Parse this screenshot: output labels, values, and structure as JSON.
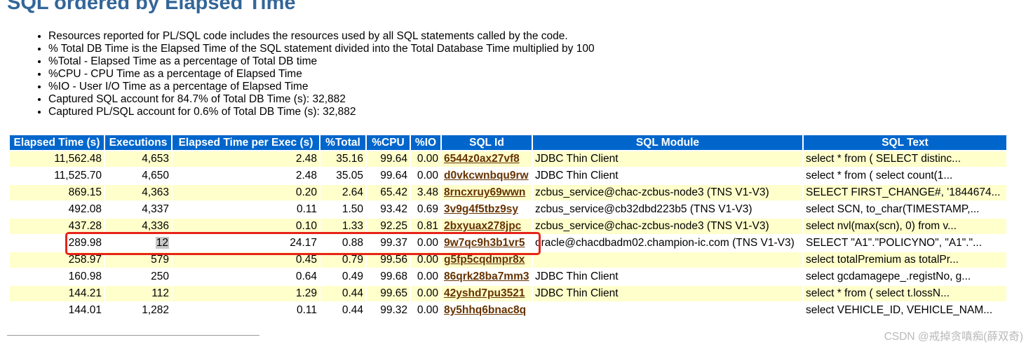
{
  "report": {
    "title": "SQL ordered by Elapsed Time",
    "notes": [
      "Resources reported for PL/SQL code includes the resources used by all SQL statements called by the code.",
      "% Total DB Time is the Elapsed Time of the SQL statement divided into the Total Database Time multiplied by 100",
      "%Total - Elapsed Time as a percentage of Total DB time",
      "%CPU - CPU Time as a percentage of Elapsed Time",
      "%IO - User I/O Time as a percentage of Elapsed Time",
      "Captured SQL account for 84.7% of Total DB Time (s): 32,882",
      "Captured PL/SQL account for 0.6% of Total DB Time (s): 32,882"
    ]
  },
  "table": {
    "columns": [
      "Elapsed Time (s)",
      "Executions",
      "Elapsed Time per Exec (s)",
      "%Total",
      "%CPU",
      "%IO",
      "SQL Id",
      "SQL Module",
      "SQL Text"
    ],
    "rows": [
      {
        "elapsed": "11,562.48",
        "executions": "4,653",
        "per_exec": "2.48",
        "total": "35.16",
        "cpu": "99.64",
        "io": "0.00",
        "sql_id": "6544z0ax27vf8",
        "module": "JDBC Thin Client",
        "text": "select * from ( SELECT distinc..."
      },
      {
        "elapsed": "11,525.70",
        "executions": "4,650",
        "per_exec": "2.48",
        "total": "35.05",
        "cpu": "99.64",
        "io": "0.00",
        "sql_id": "d0vkcwnbqu9rw",
        "module": "JDBC Thin Client",
        "text": "select * from ( select count(1..."
      },
      {
        "elapsed": "869.15",
        "executions": "4,363",
        "per_exec": "0.20",
        "total": "2.64",
        "cpu": "65.42",
        "io": "3.48",
        "sql_id": "8rncxruy69wwn",
        "module": "zcbus_service@chac-zcbus-node3 (TNS V1-V3)",
        "text": "SELECT FIRST_CHANGE#, '1844674..."
      },
      {
        "elapsed": "492.08",
        "executions": "4,337",
        "per_exec": "0.11",
        "total": "1.50",
        "cpu": "93.42",
        "io": "0.69",
        "sql_id": "3v9g4f5tbz9sy",
        "module": "zcbus_service@cb32dbd223b5 (TNS V1-V3)",
        "text": "select SCN, to_char(TIMESTAMP,..."
      },
      {
        "elapsed": "437.28",
        "executions": "4,336",
        "per_exec": "0.10",
        "total": "1.33",
        "cpu": "92.25",
        "io": "0.81",
        "sql_id": "2bxyuax278jpc",
        "module": "zcbus_service@chac-zcbus-node3 (TNS V1-V3)",
        "text": "select nvl(max(scn), 0) from v..."
      },
      {
        "elapsed": "289.98",
        "executions": "12",
        "per_exec": "24.17",
        "total": "0.88",
        "cpu": "99.37",
        "io": "0.00",
        "sql_id": "9w7qc9h3b1vr5",
        "module": "oracle@chacdbadm02.champion-ic.com (TNS V1-V3)",
        "text": "SELECT \"A1\".\"POLICYNO\", \"A1\".\"..."
      },
      {
        "elapsed": "258.97",
        "executions": "579",
        "per_exec": "0.45",
        "total": "0.79",
        "cpu": "99.56",
        "io": "0.00",
        "sql_id": "g5fp5cqdmpr8x",
        "module": "",
        "text": "select totalPremium as totalPr..."
      },
      {
        "elapsed": "160.98",
        "executions": "250",
        "per_exec": "0.64",
        "total": "0.49",
        "cpu": "99.68",
        "io": "0.00",
        "sql_id": "86qrk28ba7mm3",
        "module": "JDBC Thin Client",
        "text": "select gcdamagepe_.registNo, g..."
      },
      {
        "elapsed": "144.21",
        "executions": "112",
        "per_exec": "1.29",
        "total": "0.44",
        "cpu": "99.65",
        "io": "0.00",
        "sql_id": "42yshd7pu3521",
        "module": "JDBC Thin Client",
        "text": "select * from ( select t.lossN..."
      },
      {
        "elapsed": "144.01",
        "executions": "1,282",
        "per_exec": "0.11",
        "total": "0.44",
        "cpu": "99.32",
        "io": "0.00",
        "sql_id": "8y5hhq6bnac8q",
        "module": "",
        "text": "select VEHICLE_ID, VEHICLE_NAM..."
      }
    ]
  },
  "watermark": "CSDN @戒掉贪嗔痴(薛双奇)",
  "colors": {
    "title": "#336699",
    "header_bg": "#0066cc",
    "odd_row_bg": "#ffffcc",
    "sql_id_link": "#663300",
    "highlight_box": "#e8231a"
  }
}
